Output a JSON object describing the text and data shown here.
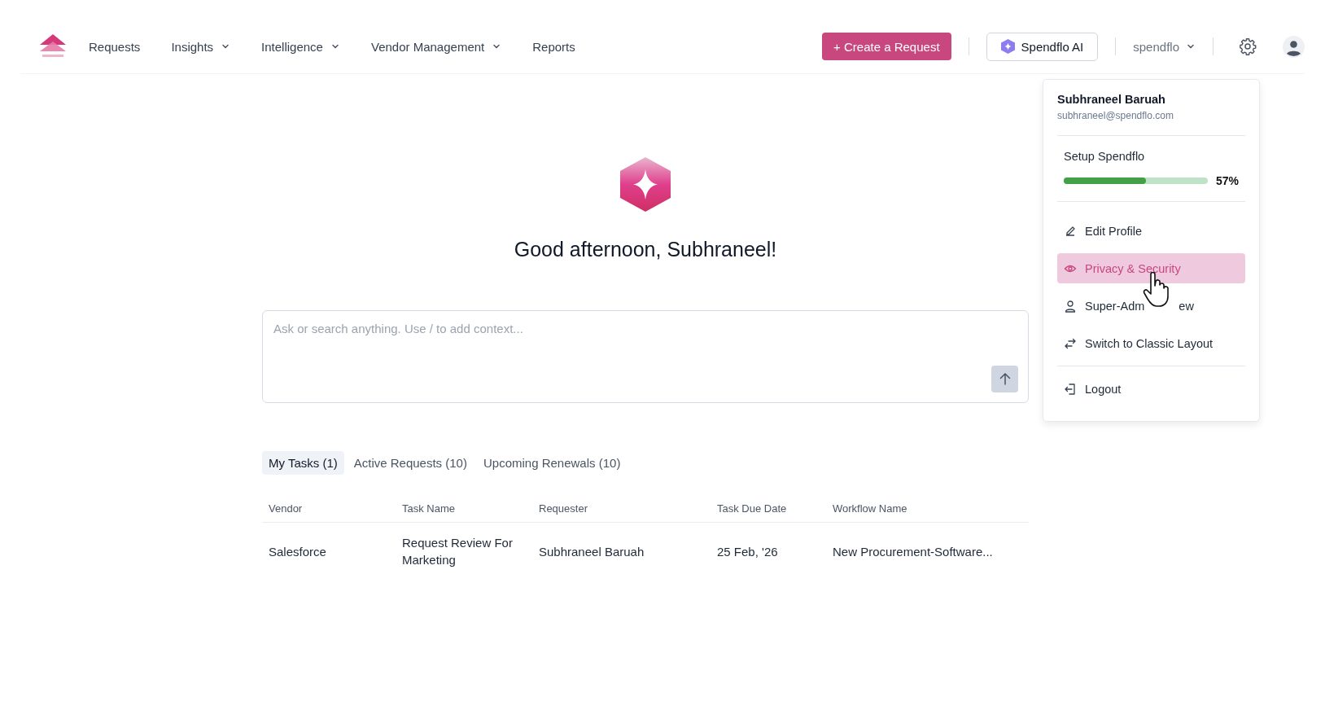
{
  "nav": {
    "items": [
      {
        "label": "Requests",
        "dropdown": false
      },
      {
        "label": "Insights",
        "dropdown": true
      },
      {
        "label": "Intelligence",
        "dropdown": true
      },
      {
        "label": "Vendor Management",
        "dropdown": true
      },
      {
        "label": "Reports",
        "dropdown": false
      }
    ],
    "create_button": "+ Create a Request",
    "ai_button": "Spendflo AI",
    "workspace": "spendflo"
  },
  "home": {
    "greeting": "Good afternoon, Subhraneel!",
    "search": {
      "placeholder": "Ask or search anything. Use / to add context..."
    }
  },
  "tabs": [
    {
      "label": "My Tasks (1)",
      "selected": true
    },
    {
      "label": "Active Requests (10)",
      "selected": false
    },
    {
      "label": "Upcoming Renewals (10)",
      "selected": false
    }
  ],
  "table": {
    "columns": [
      "Vendor",
      "Task Name",
      "Requester",
      "Task Due Date",
      "Workflow Name"
    ],
    "rows": [
      [
        "Salesforce",
        "Request Review For Marketing",
        "Subhraneel Baruah",
        "25 Feb, '26",
        "New Procurement-Software..."
      ]
    ]
  },
  "profile_menu": {
    "name": "Subhraneel Baruah",
    "email": "subhraneel@spendflo.com",
    "setup": {
      "label": "Setup Spendflo",
      "level": 0.57,
      "reading": "57%"
    },
    "items": [
      {
        "kind": "edit",
        "label": "Edit Profile",
        "selected": false
      },
      {
        "kind": "privacy",
        "label": "Privacy & Security",
        "selected": true
      },
      {
        "kind": "user",
        "label": "Super-Adm",
        "label_tail": "ew",
        "selected": false
      },
      {
        "kind": "switch",
        "label": "Switch to Classic Layout",
        "selected": false
      },
      {
        "kind": "logout",
        "label": "Logout",
        "selected": false
      }
    ]
  }
}
